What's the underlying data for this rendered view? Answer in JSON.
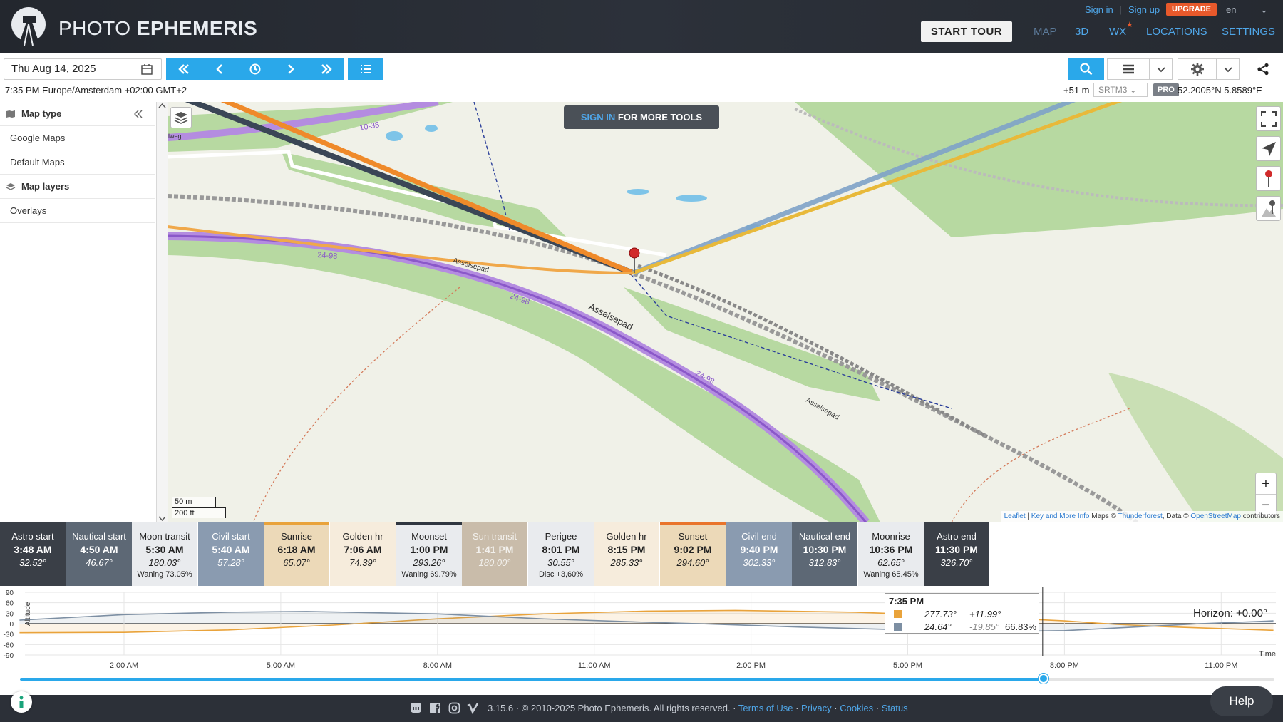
{
  "header": {
    "brand_light": "PHOTO",
    "brand_bold": "EPHEMERIS",
    "sign_in": "Sign in",
    "separator": "|",
    "sign_up": "Sign up",
    "upgrade": "UPGRADE",
    "language": "en",
    "start_tour": "START TOUR",
    "tabs": [
      "MAP",
      "3D",
      "WX",
      "LOCATIONS",
      "SETTINGS"
    ],
    "wx_star": "★"
  },
  "toolbar": {
    "date": "Thu Aug 14, 2025",
    "time_line": "7:35 PM Europe/Amsterdam +02:00 GMT+2",
    "elevation": "+51 m",
    "dem": "SRTM3",
    "pro": "PRO",
    "coords": "52.2005°N 5.8589°E"
  },
  "sidebar": {
    "items": [
      {
        "label": "Map type",
        "head": true
      },
      {
        "label": "Google Maps",
        "head": false
      },
      {
        "label": "Default Maps",
        "head": false
      },
      {
        "label": "Map layers",
        "head": true
      },
      {
        "label": "Overlays",
        "head": false
      }
    ]
  },
  "map": {
    "signin_hl": "SIGN IN",
    "signin_rest": " FOR MORE TOOLS",
    "road_labels": [
      "10-38",
      "24-98",
      "24-98",
      "24-98",
      "Asselsepad",
      "Asselsepad",
      "Asselsepad",
      "lweg"
    ],
    "scale_m": "50 m",
    "scale_ft": "200 ft",
    "zoom_in": "+",
    "zoom_out": "−",
    "attribution": {
      "leaflet": "Leaflet",
      "sep1": " | ",
      "key": "Key and More Info",
      "mid": " Maps © ",
      "thunder": "Thunderforest",
      "data": ", Data © ",
      "osm": "OpenStreetMap",
      "end": " contributors"
    }
  },
  "events": [
    {
      "name": "Astro start",
      "time": "3:48 AM",
      "az": "32.52°",
      "extra": "",
      "bg": "#3a3f47",
      "fg": "#ffffff",
      "top": ""
    },
    {
      "name": "Nautical start",
      "time": "4:50 AM",
      "az": "46.67°",
      "extra": "",
      "bg": "#5d6875",
      "fg": "#ffffff",
      "top": ""
    },
    {
      "name": "Moon transit",
      "time": "5:30 AM",
      "az": "180.03°",
      "extra": "Waning 73.05%",
      "bg": "#e9ebee",
      "fg": "#222222",
      "top": ""
    },
    {
      "name": "Civil start",
      "time": "5:40 AM",
      "az": "57.28°",
      "extra": "",
      "bg": "#8a9bb0",
      "fg": "#ffffff",
      "top": ""
    },
    {
      "name": "Sunrise",
      "time": "6:18 AM",
      "az": "65.07°",
      "extra": "",
      "bg": "#ecd9b8",
      "fg": "#222222",
      "top": "#e9a33b"
    },
    {
      "name": "Golden hr",
      "time": "7:06 AM",
      "az": "74.39°",
      "extra": "",
      "bg": "#f6ecdc",
      "fg": "#222222",
      "top": ""
    },
    {
      "name": "Moonset",
      "time": "1:00 PM",
      "az": "293.26°",
      "extra": "Waning 69.79%",
      "bg": "#e9ebee",
      "fg": "#222222",
      "top": "#2f3640"
    },
    {
      "name": "Sun transit",
      "time": "1:41 PM",
      "az": "180.00°",
      "extra": "",
      "bg": "#c9bcaa",
      "fg": "#f2f0ec",
      "top": ""
    },
    {
      "name": "Perigee",
      "time": "8:01 PM",
      "az": "30.55°",
      "extra": "Disc +3,60%",
      "bg": "#e9ebee",
      "fg": "#222222",
      "top": ""
    },
    {
      "name": "Golden hr",
      "time": "8:15 PM",
      "az": "285.33°",
      "extra": "",
      "bg": "#f6ecdc",
      "fg": "#222222",
      "top": ""
    },
    {
      "name": "Sunset",
      "time": "9:02 PM",
      "az": "294.60°",
      "extra": "",
      "bg": "#ecd9b8",
      "fg": "#222222",
      "top": "#e9742b"
    },
    {
      "name": "Civil end",
      "time": "9:40 PM",
      "az": "302.33°",
      "extra": "",
      "bg": "#8a9bb0",
      "fg": "#ffffff",
      "top": ""
    },
    {
      "name": "Nautical end",
      "time": "10:30 PM",
      "az": "312.83°",
      "extra": "",
      "bg": "#5d6875",
      "fg": "#ffffff",
      "top": ""
    },
    {
      "name": "Moonrise",
      "time": "10:36 PM",
      "az": "62.65°",
      "extra": "Waning 65.45%",
      "bg": "#e9ebee",
      "fg": "#222222",
      "top": ""
    },
    {
      "name": "Astro end",
      "time": "11:30 PM",
      "az": "326.70°",
      "extra": "",
      "bg": "#3a3f47",
      "fg": "#ffffff",
      "top": ""
    }
  ],
  "chart_data": {
    "type": "line",
    "ylabel": "Altitude",
    "xlabel": "Time",
    "y_ticks": [
      "90",
      "60",
      "30",
      "0",
      "-30",
      "-60",
      "-90"
    ],
    "ylim": [
      -90,
      90
    ],
    "x_ticks": [
      "2:00 AM",
      "5:00 AM",
      "8:00 AM",
      "11:00 AM",
      "2:00 PM",
      "5:00 PM",
      "8:00 PM",
      "11:00 PM"
    ],
    "series": [
      {
        "hours": [
          0,
          2,
          4,
          6,
          8,
          10,
          12,
          13.7,
          16,
          18,
          20,
          21,
          22,
          24
        ],
        "values": [
          -26,
          -25,
          -18,
          -4,
          14,
          28,
          36,
          38,
          33,
          22,
          8,
          -2,
          -9,
          -19
        ],
        "color": "#e9a33b"
      },
      {
        "hours": [
          0,
          2,
          4,
          5.5,
          8,
          10,
          12,
          13,
          15,
          17,
          19,
          20,
          22.6,
          24
        ],
        "values": [
          10,
          26,
          33,
          35,
          28,
          14,
          4,
          0,
          -10,
          -18,
          -22,
          -20,
          0,
          8
        ],
        "color": "#7d8fa3"
      }
    ],
    "current_hour": 19.583,
    "horizon": "Horizon: +0.00°"
  },
  "tooltip": {
    "time": "7:35 PM",
    "sun_az": "277.73°",
    "sun_alt": "+11.99°",
    "moon_az": "24.64°",
    "moon_alt": "-19.85°",
    "moon_illum": "66.83%"
  },
  "slider": {
    "fraction": 0.8159
  },
  "footer": {
    "copyright": "3.15.6 · © 2010-2025 Photo Ephemeris. All rights reserved. ·",
    "terms": "Terms of Use",
    "dot1": " · ",
    "privacy": "Privacy",
    "dot2": " · ",
    "cookies": "Cookies",
    "dot3": " · ",
    "status": "Status",
    "help": "Help"
  }
}
